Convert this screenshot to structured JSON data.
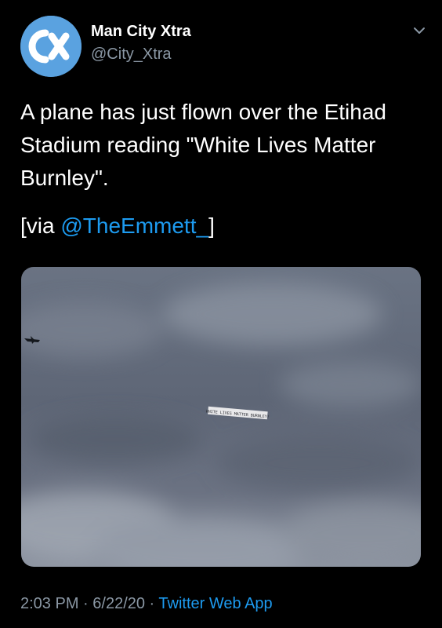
{
  "account": {
    "display_name": "Man City Xtra",
    "handle": "@City_Xtra",
    "avatar_icon": "cx-logo",
    "avatar_color": "#5aa2e0"
  },
  "tweet": {
    "text": "A plane has just flown over the Etihad Stadium reading \"White Lives Matter Burnley\".",
    "via_prefix": "[via ",
    "via_mention": "@TheEmmett_",
    "via_suffix": "]",
    "banner_text": "WHITE LIVES MATTER BURNLEY!"
  },
  "meta": {
    "time": "2:03 PM",
    "separator": " · ",
    "date": "6/22/20",
    "source": "Twitter Web App"
  },
  "colors": {
    "background": "#000000",
    "text": "#ffffff",
    "secondary": "#8b98a5",
    "link": "#1d9bf0"
  }
}
